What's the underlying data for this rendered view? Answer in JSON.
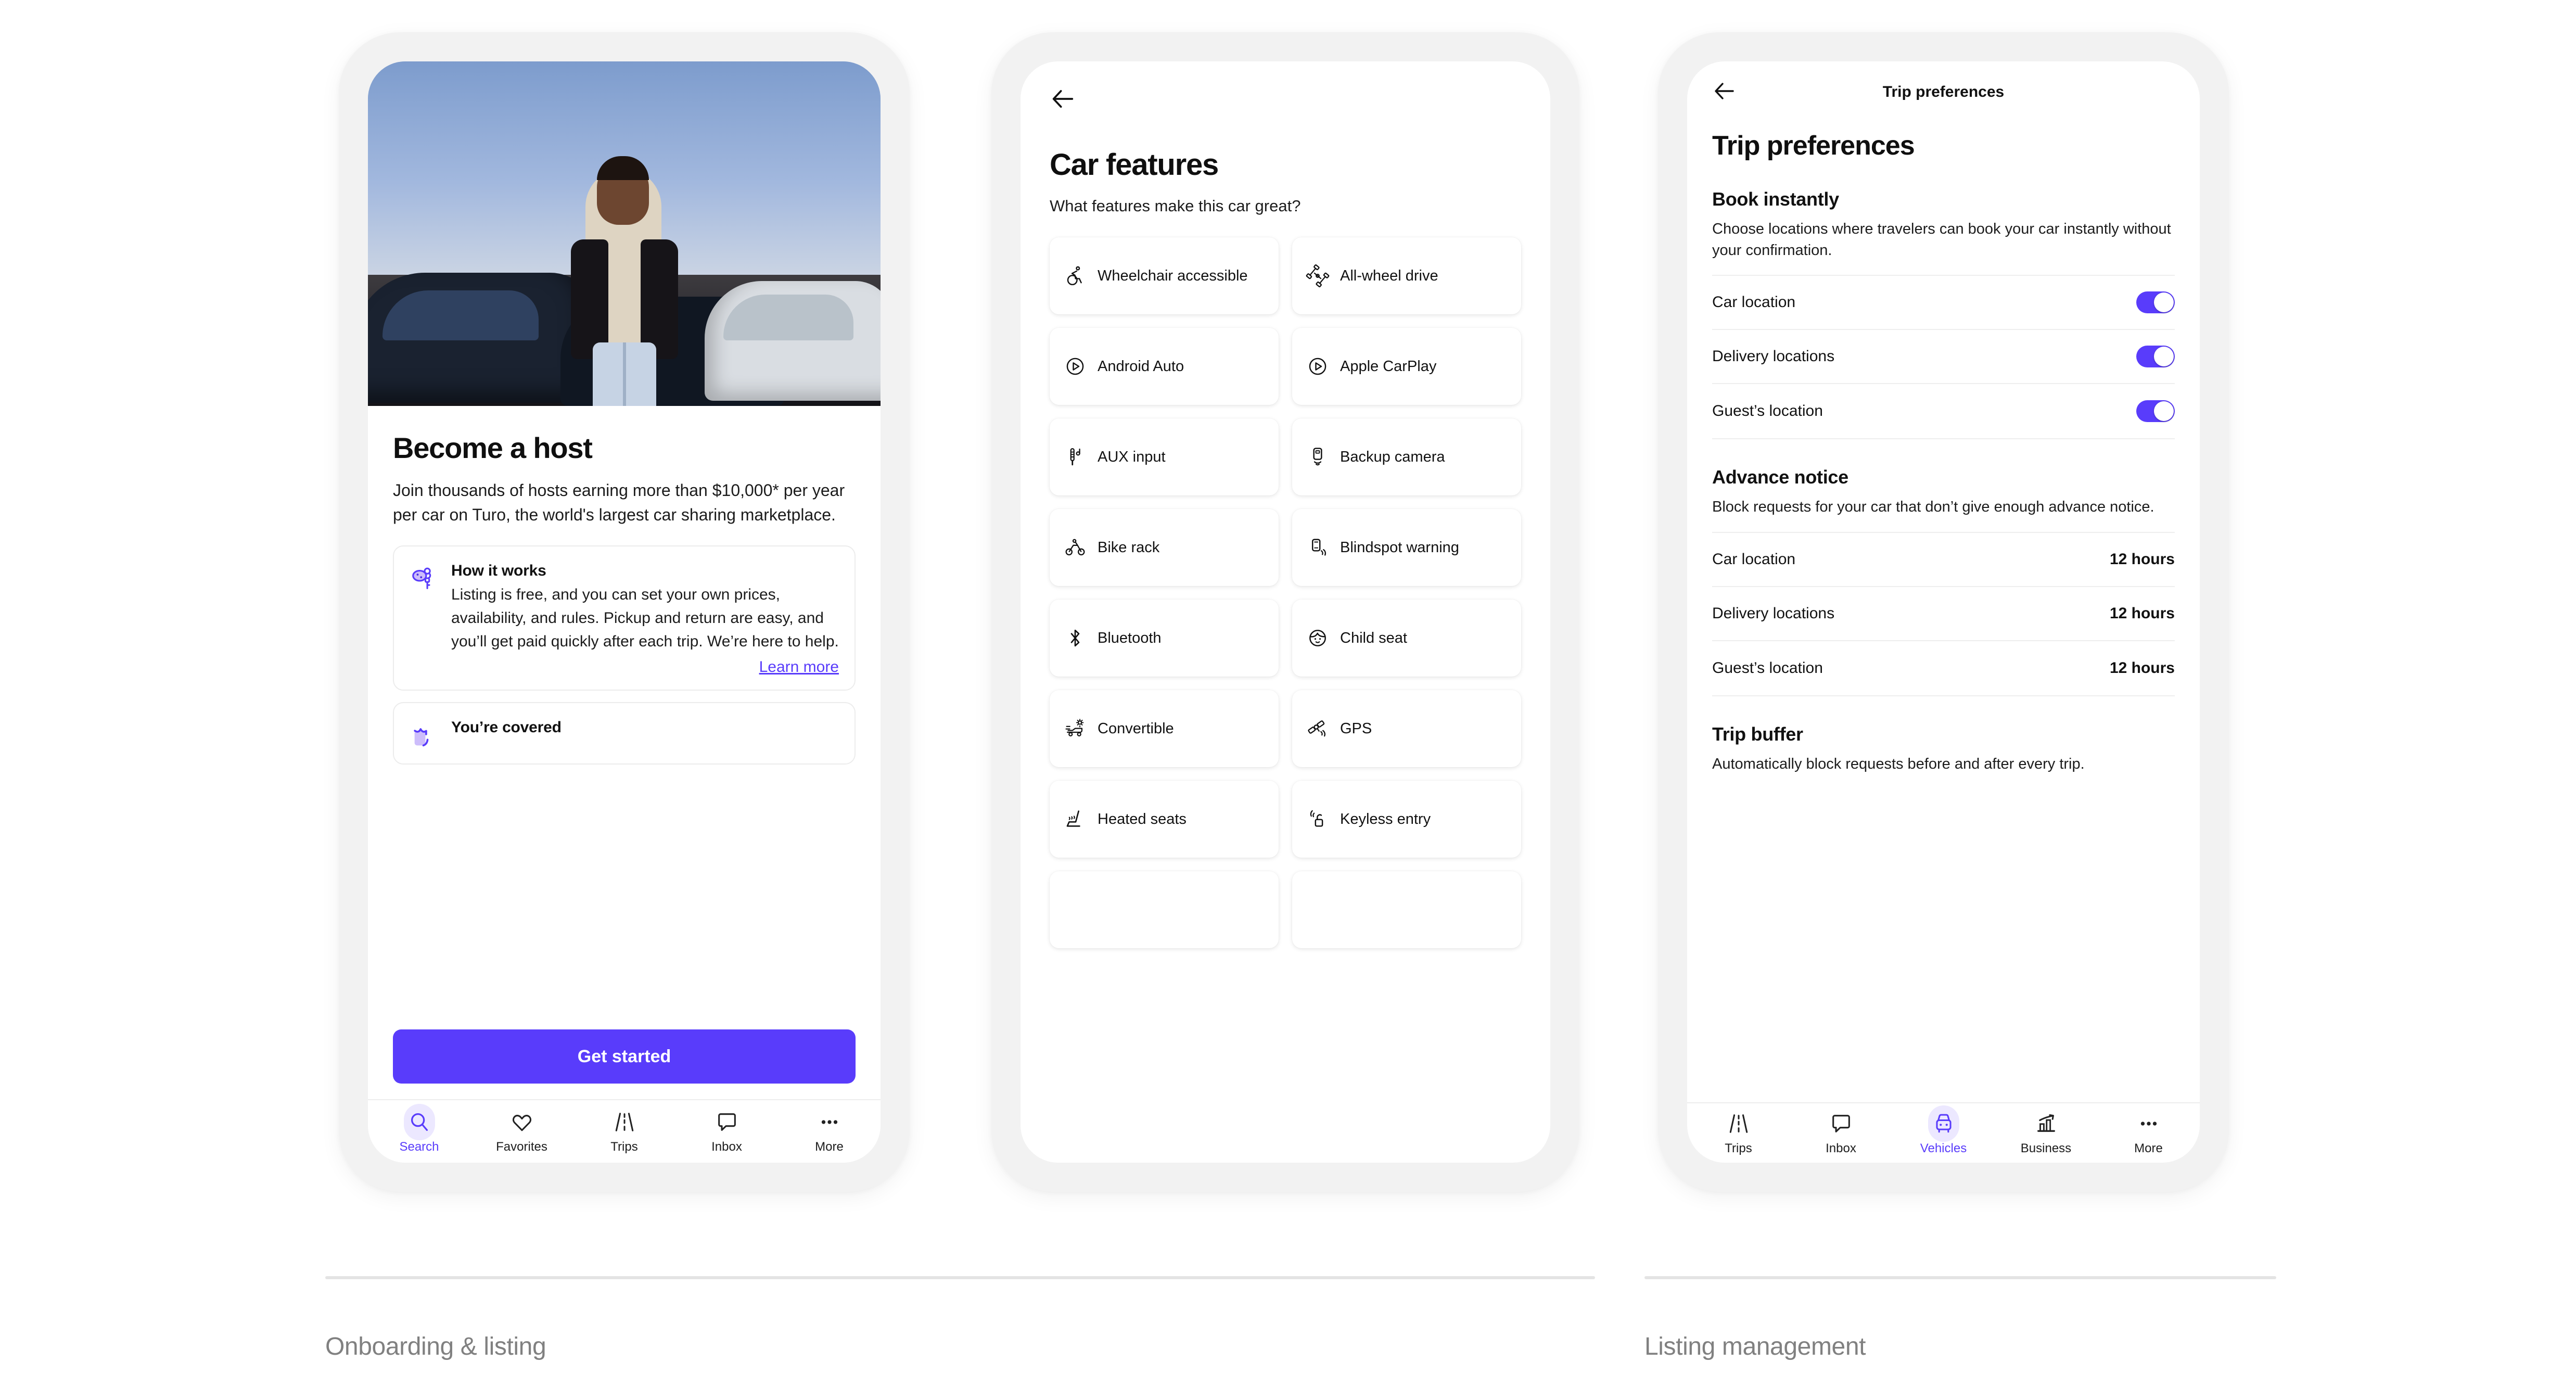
{
  "theme": {
    "accent": "#593CFB",
    "accent_light": "#ece8ff",
    "frame": "#f2f2f2",
    "muted": "#808080"
  },
  "phone1": {
    "title": "Become a host",
    "body": "Join thousands of hosts earning more than $10,000* per year per car on Turo, the world's largest car sharing marketplace.",
    "cards": [
      {
        "icon": "keys-icon",
        "title": "How it works",
        "text": "Listing is free, and you can set your own prices, availability, and rules. Pickup and return are easy, and you’ll get paid quickly after each trip. We’re here to help.",
        "link": "Learn more"
      },
      {
        "icon": "shield-icon",
        "title": "You’re covered",
        "text": "",
        "link": ""
      }
    ],
    "cta": "Get started",
    "tabs": [
      {
        "label": "Search",
        "icon": "search-icon",
        "active": true
      },
      {
        "label": "Favorites",
        "icon": "heart-icon",
        "active": false
      },
      {
        "label": "Trips",
        "icon": "road-icon",
        "active": false
      },
      {
        "label": "Inbox",
        "icon": "message-icon",
        "active": false
      },
      {
        "label": "More",
        "icon": "ellipsis-icon",
        "active": false
      }
    ]
  },
  "phone2": {
    "back": "back-arrow-icon",
    "title": "Car features",
    "subtitle": "What features make this car great?",
    "features": [
      {
        "label": "Wheelchair accessible",
        "icon": "wheelchair-icon"
      },
      {
        "label": "All-wheel drive",
        "icon": "awd-icon"
      },
      {
        "label": "Android Auto",
        "icon": "play-circle-icon"
      },
      {
        "label": "Apple CarPlay",
        "icon": "play-circle-icon"
      },
      {
        "label": "AUX input",
        "icon": "aux-jack-icon"
      },
      {
        "label": "Backup camera",
        "icon": "backup-camera-icon"
      },
      {
        "label": "Bike rack",
        "icon": "bicycle-icon"
      },
      {
        "label": "Blindspot warning",
        "icon": "blindspot-icon"
      },
      {
        "label": "Bluetooth",
        "icon": "bluetooth-icon"
      },
      {
        "label": "Child seat",
        "icon": "child-face-icon"
      },
      {
        "label": "Convertible",
        "icon": "convertible-icon"
      },
      {
        "label": "GPS",
        "icon": "gps-satellite-icon"
      },
      {
        "label": "Heated seats",
        "icon": "heated-seat-icon"
      },
      {
        "label": "Keyless entry",
        "icon": "keyless-entry-icon"
      }
    ]
  },
  "phone3": {
    "nav_title": "Trip preferences",
    "page_title": "Trip preferences",
    "sections": [
      {
        "heading": "Book instantly",
        "desc": "Choose locations where travelers can book your car instantly without your confirmation.",
        "rows": [
          {
            "label": "Car location",
            "toggle": true
          },
          {
            "label": "Delivery locations",
            "toggle": true
          },
          {
            "label": "Guest’s location",
            "toggle": true
          }
        ]
      },
      {
        "heading": "Advance notice",
        "desc": "Block requests for your car that don’t give enough advance notice.",
        "rows": [
          {
            "label": "Car location",
            "value": "12 hours"
          },
          {
            "label": "Delivery locations",
            "value": "12 hours"
          },
          {
            "label": "Guest’s location",
            "value": "12 hours"
          }
        ]
      },
      {
        "heading": "Trip buffer",
        "desc": "Automatically block requests before and after every trip.",
        "rows": []
      }
    ],
    "tabs": [
      {
        "label": "Trips",
        "icon": "road-icon",
        "active": false
      },
      {
        "label": "Inbox",
        "icon": "message-icon",
        "active": false
      },
      {
        "label": "Vehicles",
        "icon": "car-icon",
        "active": true
      },
      {
        "label": "Business",
        "icon": "chart-icon",
        "active": false
      },
      {
        "label": "More",
        "icon": "ellipsis-icon",
        "active": false
      }
    ]
  },
  "footer": {
    "section1": "Onboarding & listing",
    "section2": "Listing management"
  }
}
